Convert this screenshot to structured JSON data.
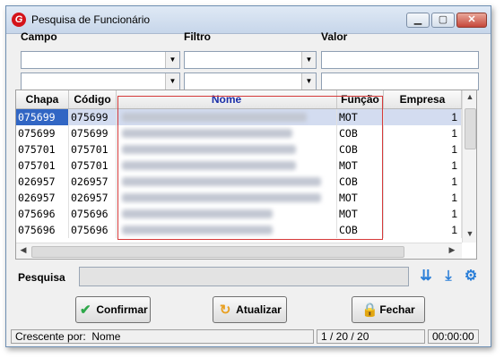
{
  "window": {
    "title": "Pesquisa de Funcionário",
    "minimize": "▁",
    "maximize": "▢",
    "close": "✕"
  },
  "filters": {
    "campo_label": "Campo",
    "filtro_label": "Filtro",
    "valor_label": "Valor"
  },
  "grid": {
    "headers": [
      "Chapa",
      "Código",
      "Nome",
      "Função",
      "Empresa"
    ],
    "rows": [
      {
        "chapa": "075699",
        "codigo": "075699",
        "funcao": "MOT",
        "empresa": "1"
      },
      {
        "chapa": "075699",
        "codigo": "075699",
        "funcao": "COB",
        "empresa": "1"
      },
      {
        "chapa": "075701",
        "codigo": "075701",
        "funcao": "COB",
        "empresa": "1"
      },
      {
        "chapa": "075701",
        "codigo": "075701",
        "funcao": "MOT",
        "empresa": "1"
      },
      {
        "chapa": "026957",
        "codigo": "026957",
        "funcao": "COB",
        "empresa": "1"
      },
      {
        "chapa": "026957",
        "codigo": "026957",
        "funcao": "MOT",
        "empresa": "1"
      },
      {
        "chapa": "075696",
        "codigo": "075696",
        "funcao": "MOT",
        "empresa": "1"
      },
      {
        "chapa": "075696",
        "codigo": "075696",
        "funcao": "COB",
        "empresa": "1"
      }
    ]
  },
  "search": {
    "label": "Pesquisa",
    "value": ""
  },
  "buttons": {
    "confirm": "Confirmar",
    "refresh": "Atualizar",
    "close": "Fechar"
  },
  "status": {
    "sort_label": "Crescente por:",
    "sort_field": "Nome",
    "pagination": "1 / 20 / 20",
    "timer": "00:00:00"
  },
  "colors": {
    "selection": "#3166c4",
    "highlight_box": "#d63a3a",
    "header_link": "#1a2ea8"
  }
}
